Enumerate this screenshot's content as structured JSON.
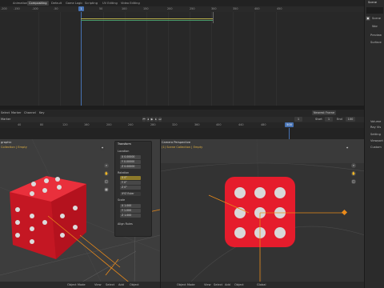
{
  "topbar": {
    "workspaces": [
      "Animation",
      "Compositing",
      "Default",
      "Game Logic",
      "Scripting",
      "UV Editing",
      "Video Editing"
    ],
    "active": "Compositing",
    "scene_label": "Scene"
  },
  "graph_ruler": [
    "-200",
    "-150",
    "-100",
    "-50",
    "0",
    "50",
    "100",
    "150",
    "200",
    "250",
    "300",
    "350",
    "400",
    "450"
  ],
  "graph_current_frame": "1",
  "props": {
    "scene": "Scene",
    "items": [
      "Scene",
      "Wor",
      "Preview",
      "Surface",
      "Volume",
      "Ray Vis",
      "Setting",
      "Viewport",
      "Custom"
    ]
  },
  "timeline": {
    "menu": [
      "Select",
      "Marker",
      "Channel",
      "Key"
    ],
    "mode": "Marker",
    "nearest": "Nearest Frame",
    "start_label": "Start",
    "start_value": "1",
    "end_label": "End",
    "end_value": "100",
    "ruler": [
      "0",
      "40",
      "80",
      "120",
      "160",
      "200",
      "240",
      "280",
      "320",
      "360",
      "400",
      "440",
      "480",
      "500"
    ],
    "current_frame": "500"
  },
  "viewport_left": {
    "title": "graphic",
    "collection": "Collection | Empty",
    "menus": [
      "Object Mode",
      "View",
      "Select",
      "Add",
      "Object"
    ],
    "orientation": "Global"
  },
  "viewport_right": {
    "title": "Camera Perspective",
    "collection": "(1) Scene Collection | Empty",
    "menus": [
      "Object Mode",
      "View",
      "Select",
      "Add",
      "Object"
    ],
    "orientation": "Global"
  },
  "npanel": {
    "section": "Transform",
    "location_label": "Location",
    "location": [
      {
        "axis": "X",
        "value": "0.00000"
      },
      {
        "axis": "Y",
        "value": "0.00000"
      },
      {
        "axis": "Z",
        "value": "0.00000"
      }
    ],
    "rotation_label": "Rotation",
    "rotation": [
      {
        "axis": "X",
        "value": "0°"
      },
      {
        "axis": "Y",
        "value": "0°"
      },
      {
        "axis": "Z",
        "value": "0°"
      }
    ],
    "rotation_mode": "XYZ Euler",
    "scale_label": "Scale",
    "scale": [
      {
        "axis": "X",
        "value": "1.000"
      },
      {
        "axis": "Y",
        "value": "1.000"
      },
      {
        "axis": "Z",
        "value": "1.000"
      }
    ],
    "footer": "Align Rules"
  },
  "colors": {
    "accent": "#4772b3",
    "die": "#e51c2c",
    "keyframe": "#e98a1a"
  }
}
